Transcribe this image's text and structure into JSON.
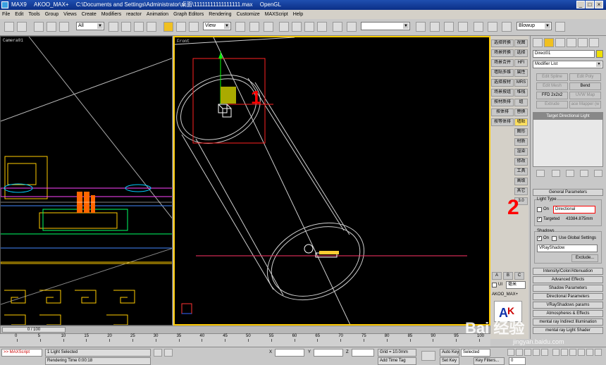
{
  "title": {
    "app": "MAX9",
    "plugin": "AKOO_MAX+",
    "path": "C:\\Documents and Settings\\Administrator\\桌面\\11111111111111111.max",
    "renderer": "OpenGL"
  },
  "menu": [
    "File",
    "Edit",
    "Tools",
    "Group",
    "Views",
    "Create",
    "Modifiers",
    "reactor",
    "Animation",
    "Graph Editors",
    "Rendering",
    "Customize",
    "MAXScript",
    "Help"
  ],
  "toolbar": {
    "selection_filter": "All",
    "ref_coord": "View",
    "render_type": "Blowup"
  },
  "viewports": {
    "camera_label": "Camera01",
    "front_label": "Front"
  },
  "cn_panel": {
    "left_col": [
      "选择转换",
      "场景转换",
      "场景合并",
      "墙贴多维",
      "选择按材",
      "场景按组",
      "按材质排",
      "按体排",
      "按等体排"
    ],
    "right_col": [
      "视图",
      "选择",
      "HFI",
      "属性",
      "MRS",
      "堆栈",
      "组",
      "替换",
      "墙贴",
      "图形",
      "材质",
      "渲染",
      "修改",
      "工具",
      "高级",
      "其它",
      "3.0"
    ],
    "abc": [
      "A",
      "B",
      "C"
    ],
    "ui_label": "UI",
    "unit_select": "毫米",
    "plugin_label": "AKOO_MAX+"
  },
  "panel": {
    "object_name": "Direct01",
    "modifier_list": "Modifier List",
    "mod_buttons": [
      "Edit Spline",
      "Edit Poly",
      "Edit Mesh",
      "Bend",
      "FFD 2x2x2",
      "UVW Map",
      "Extrude",
      "ace Mapper (w"
    ],
    "stack_item": "Target Directional Light",
    "general_params": "General Parameters",
    "light_type_label": "Light Type",
    "on_label": "On",
    "light_type_value": "Directional",
    "targeted_label": "Targeted",
    "target_distance": "43384.875mm",
    "shadows_label": "Shadows",
    "shadow_on_label": "On",
    "use_global_label": "Use Global Settings",
    "shadow_type": "VRayShadow",
    "exclude_label": "Exclude...",
    "rollouts": [
      "Intensity/Color/Attenuation",
      "Advanced Effects",
      "Shadow Parameters",
      "Directional Parameters",
      "VRayShadows params",
      "Atmospheres & Effects",
      "mental ray Indirect Illumination",
      "mental ray Light Shader"
    ]
  },
  "annotations": {
    "mark1": "1",
    "mark2": "2"
  },
  "timeline": {
    "frame_counter": "0 / 100",
    "ticks": [
      "0",
      "5",
      "10",
      "15",
      "20",
      "25",
      "30",
      "35",
      "40",
      "45",
      "50",
      "55",
      "60",
      "65",
      "70",
      "75",
      "80",
      "85",
      "90",
      "95",
      "100"
    ]
  },
  "status": {
    "maxscript": ">> MAXScript",
    "selection": "1 Light Selected",
    "render_time": "Rendering Time 0:00:18",
    "x_label": "X",
    "y_label": "Y",
    "z_label": "Z",
    "grid": "Grid = 10.0mm",
    "add_time_tag": "Add Time Tag",
    "auto_key": "Auto Key",
    "set_key": "Set Key",
    "key_mode": "Selected",
    "key_filters": "Key Filters...",
    "frame": "0"
  },
  "watermark": {
    "brand": "Bai 经验",
    "url": "jingyan.baidu.com"
  },
  "colors": {
    "accent": "#f0c020",
    "annotation": "#ff0000",
    "viewport_bg": "#000000"
  }
}
